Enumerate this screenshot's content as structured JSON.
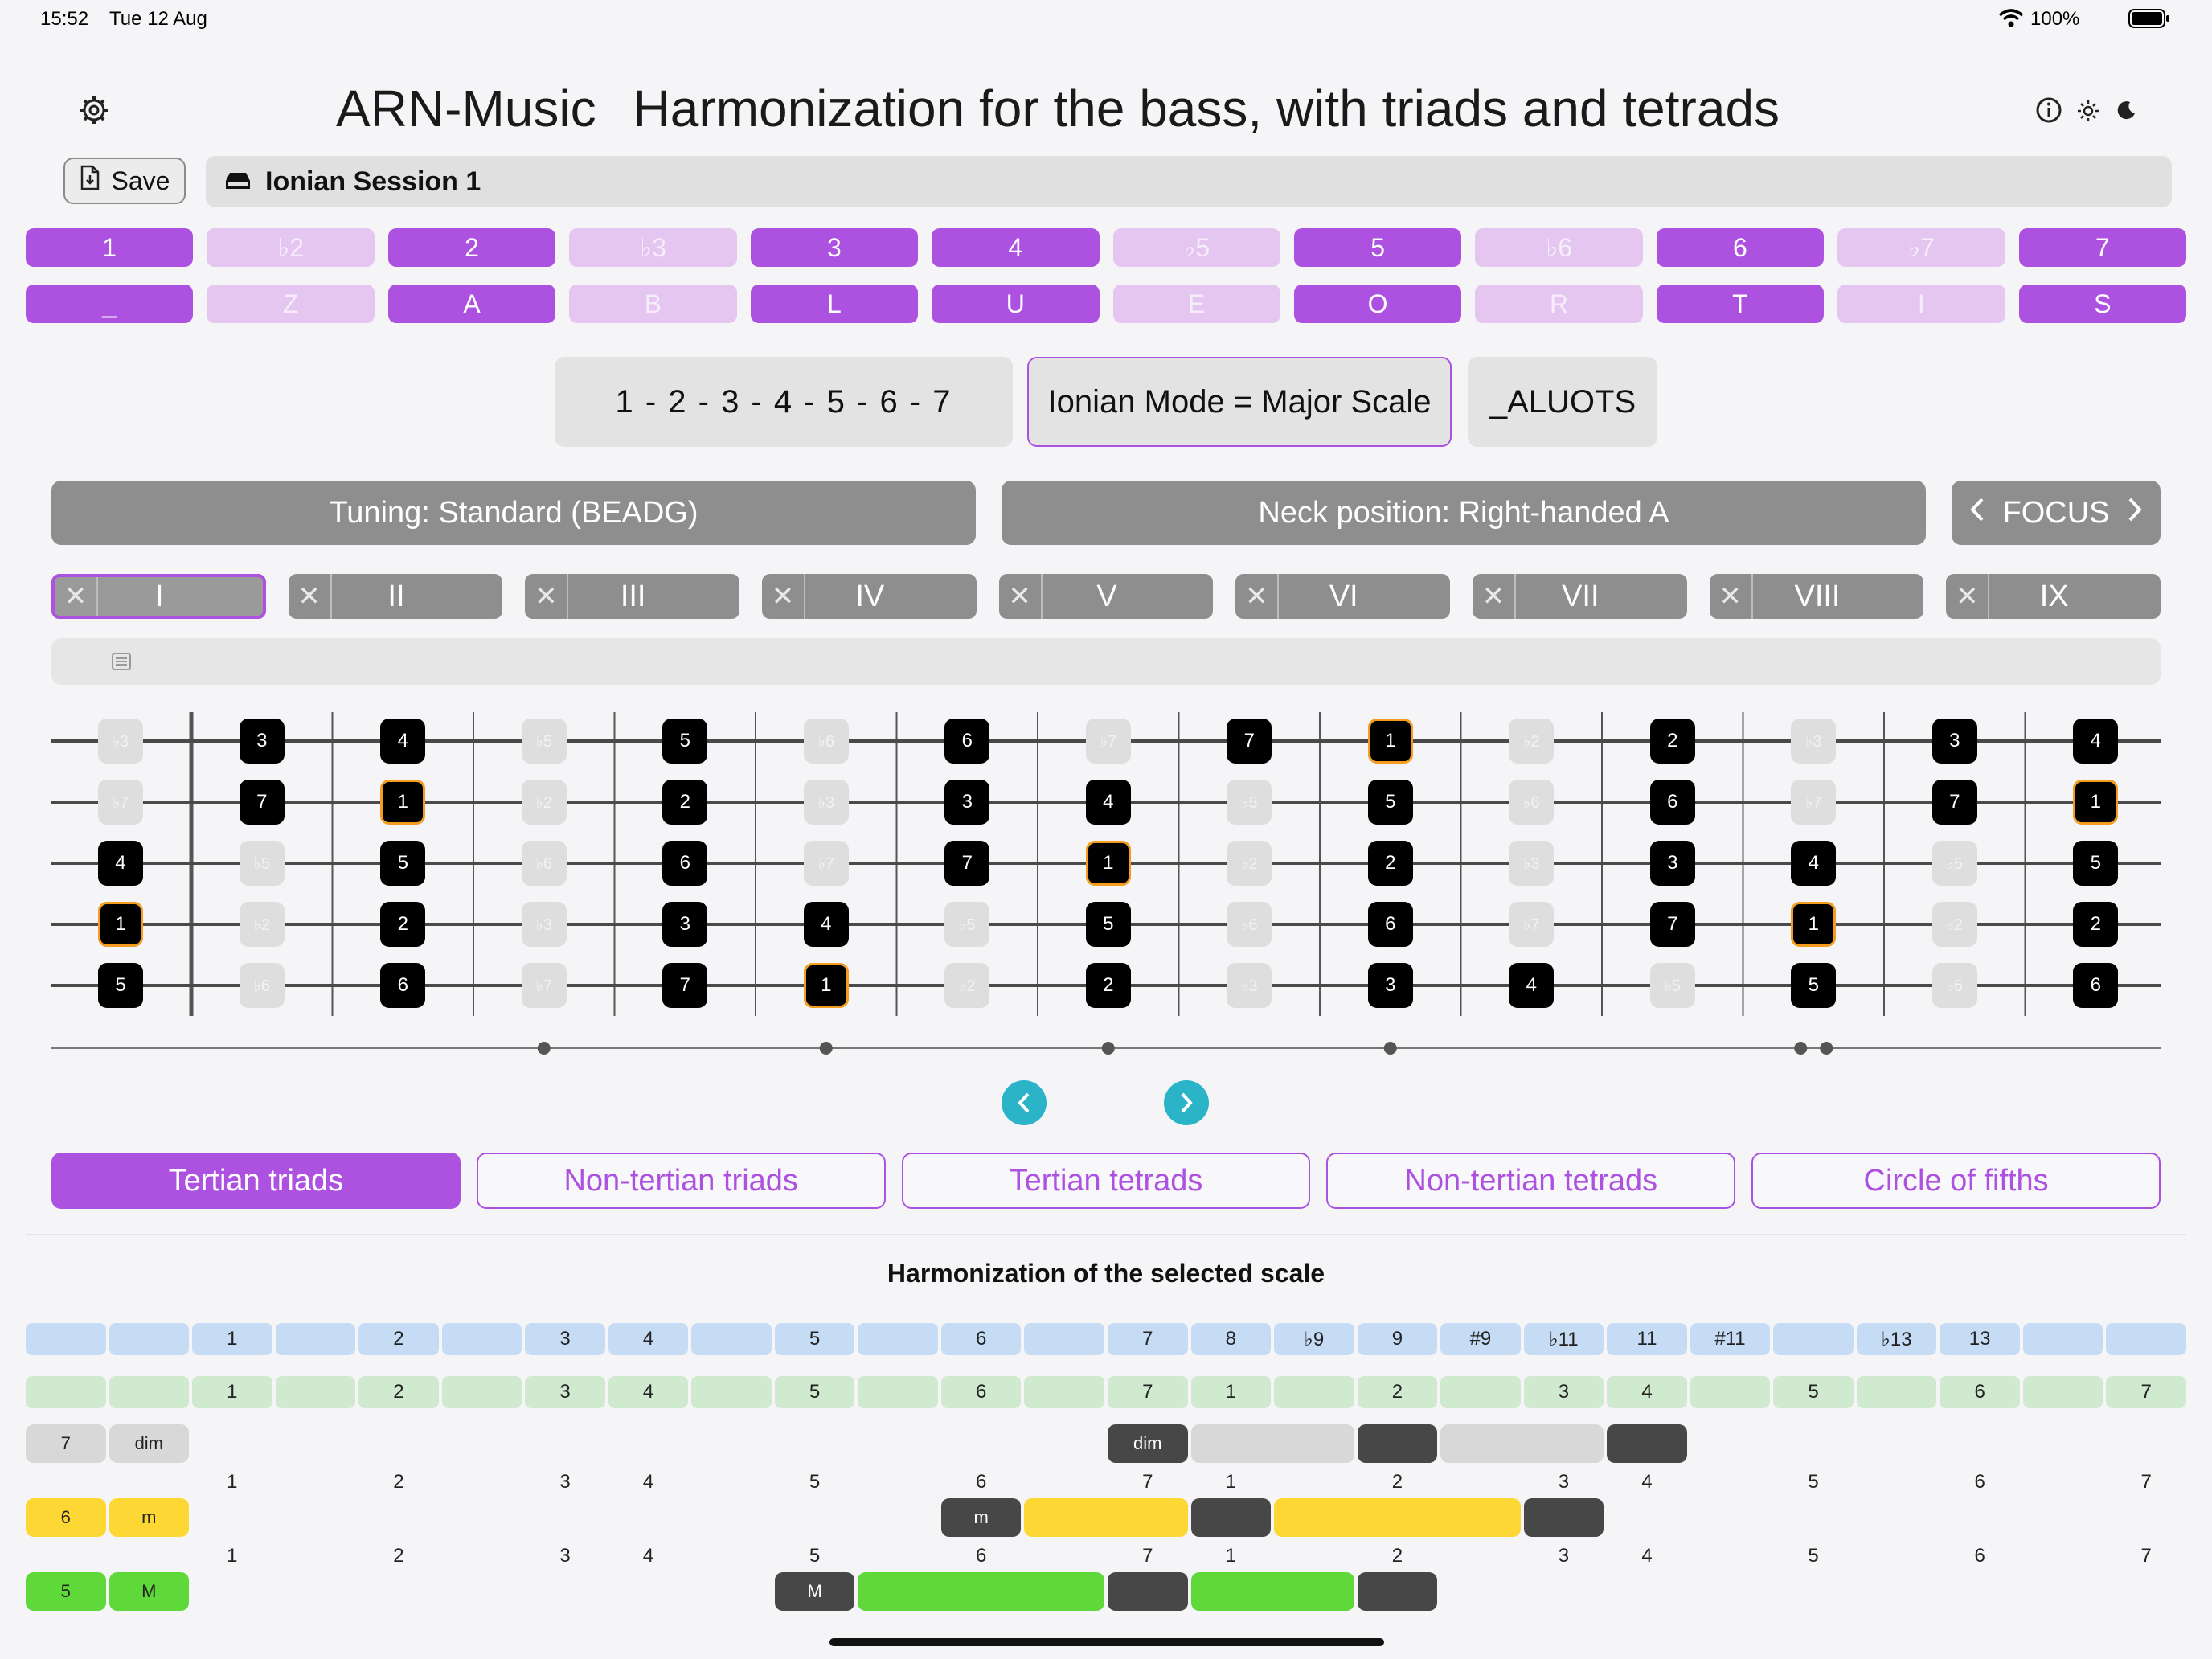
{
  "status": {
    "time": "15:52",
    "date": "Tue 12 Aug",
    "battery": "100%"
  },
  "header": {
    "app_name": "ARN-Music",
    "subtitle": "Harmonization for the bass, with triads and tetrads"
  },
  "toolbar": {
    "save_label": "Save",
    "session_name": "Ionian Session 1"
  },
  "intervals": [
    {
      "label": "1",
      "on": true
    },
    {
      "label": "♭2",
      "on": false
    },
    {
      "label": "2",
      "on": true
    },
    {
      "label": "♭3",
      "on": false
    },
    {
      "label": "3",
      "on": true
    },
    {
      "label": "4",
      "on": true
    },
    {
      "label": "♭5",
      "on": false
    },
    {
      "label": "5",
      "on": true
    },
    {
      "label": "♭6",
      "on": false
    },
    {
      "label": "6",
      "on": true
    },
    {
      "label": "♭7",
      "on": false
    },
    {
      "label": "7",
      "on": true
    }
  ],
  "letters": [
    "_",
    "Z",
    "A",
    "B",
    "L",
    "U",
    "E",
    "O",
    "R",
    "T",
    "I",
    "S"
  ],
  "mode": {
    "formula": "1 - 2 - 3 - 4 - 5 - 6 - 7",
    "name": "Ionian Mode = Major Scale",
    "code": "_ALUOTS"
  },
  "tuning_label": "Tuning: Standard (BEADG)",
  "neck_label": "Neck position: Right-handed A",
  "focus_label": "FOCUS",
  "positions": [
    {
      "label": "I",
      "selected": true
    },
    {
      "label": "II"
    },
    {
      "label": "III"
    },
    {
      "label": "IV"
    },
    {
      "label": "V"
    },
    {
      "label": "VI"
    },
    {
      "label": "VII"
    },
    {
      "label": "VIII"
    },
    {
      "label": "IX"
    }
  ],
  "fretboard": {
    "strings": [
      [
        "♭3",
        "3",
        "4",
        "♭5",
        "5",
        "♭6",
        "6",
        "♭7",
        "7",
        "1",
        "♭2",
        "2",
        "♭3",
        "3",
        "4"
      ],
      [
        "♭7",
        "7",
        "1",
        "♭2",
        "2",
        "♭3",
        "3",
        "4",
        "♭5",
        "5",
        "♭6",
        "6",
        "♭7",
        "7",
        "1"
      ],
      [
        "4",
        "♭5",
        "5",
        "♭6",
        "6",
        "♭7",
        "7",
        "1",
        "♭2",
        "2",
        "♭3",
        "3",
        "4",
        "♭5",
        "5"
      ],
      [
        "1",
        "♭2",
        "2",
        "♭3",
        "3",
        "4",
        "♭5",
        "5",
        "♭6",
        "6",
        "♭7",
        "7",
        "1",
        "♭2",
        "2"
      ],
      [
        "5",
        "♭6",
        "6",
        "♭7",
        "7",
        "1",
        "♭2",
        "2",
        "♭3",
        "3",
        "4",
        "♭5",
        "5",
        "♭6",
        "6"
      ]
    ],
    "inlays": [
      3,
      5,
      7,
      9
    ],
    "double_inlay": 12
  },
  "tabs": [
    "Tertian triads",
    "Non-tertian triads",
    "Tertian tetrads",
    "Non-tertian tetrads",
    "Circle of fifths"
  ],
  "harmonization": {
    "title": "Harmonization of the selected scale",
    "extended_row": [
      "",
      "",
      "1",
      "",
      "2",
      "",
      "3",
      "4",
      "",
      "5",
      "",
      "6",
      "",
      "7",
      "8",
      "♭9",
      "9",
      "#9",
      "♭11",
      "11",
      "#11",
      "",
      "♭13",
      "13",
      "",
      ""
    ],
    "degree_row": [
      "",
      "",
      "1",
      "",
      "2",
      "",
      "3",
      "4",
      "",
      "5",
      "",
      "6",
      "",
      "7",
      "1",
      "",
      "2",
      "",
      "3",
      "4",
      "",
      "5",
      "",
      "6",
      "",
      "7"
    ],
    "number_row": [
      "",
      "",
      "1",
      "",
      "2",
      "",
      "3",
      "4",
      "",
      "5",
      "",
      "6",
      "",
      "7",
      "1",
      "",
      "2",
      "",
      "3",
      "4",
      "",
      "5",
      "",
      "6",
      "",
      "7"
    ],
    "chords": [
      {
        "degree": "7",
        "quality": "dim",
        "tag": "dim",
        "color": "#d8d8d8"
      },
      {
        "degree": "6",
        "quality": "m",
        "tag": "m",
        "color": "#fdd835"
      },
      {
        "degree": "5",
        "quality": "M",
        "tag": "M",
        "color": "#5fd83a"
      }
    ]
  },
  "colors": {
    "accent": "#ad52e0",
    "accent_light": "#e4c6f1",
    "gray": "#8e8e8e",
    "root_outline": "#f39c1e",
    "nav": "#2bb3c7",
    "dark_chip": "#474747"
  }
}
